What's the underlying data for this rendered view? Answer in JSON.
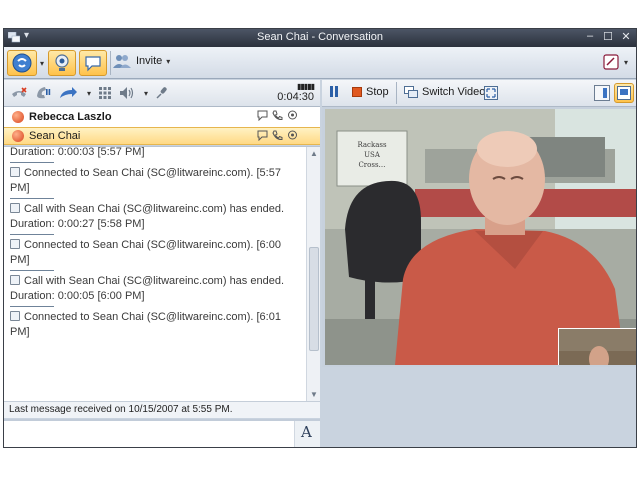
{
  "window": {
    "title": "Sean Chai - Conversation"
  },
  "toolbar": {
    "invite_label": "Invite"
  },
  "call": {
    "timer": "0:04:30"
  },
  "participants": [
    {
      "name": "Rebecca Laszlo"
    },
    {
      "name": "Sean Chai"
    }
  ],
  "history": {
    "messages": [
      {
        "line1": "Duration: 0:00:03  [5:57 PM]",
        "line2": ""
      },
      {
        "line1": "Connected to Sean Chai (SC@litwareinc.com).  [5:57",
        "line2": "PM]"
      },
      {
        "line1": "Call with Sean Chai (SC@litwareinc.com) has ended.",
        "line2": "Duration: 0:00:27  [5:58 PM]"
      },
      {
        "line1": "Connected to Sean Chai (SC@litwareinc.com).  [6:00",
        "line2": "PM]"
      },
      {
        "line1": "Call with Sean Chai (SC@litwareinc.com) has ended.",
        "line2": "Duration: 0:00:05  [6:00 PM]"
      },
      {
        "line1": "Connected to Sean Chai (SC@litwareinc.com).  [6:01",
        "line2": "PM]"
      }
    ]
  },
  "status": {
    "text": "Last message received on 10/15/2007 at 5:55 PM."
  },
  "video": {
    "stop_label": "Stop",
    "switch_label": "Switch Video",
    "sign_text": "Rackass\nUSA\nCross..."
  },
  "icons": {
    "app": "conversation-app-icon",
    "call_transfer": "phone-forward-icon",
    "hold": "hold-call-icon",
    "dialpad": "dialpad-icon",
    "volume": "speaker-icon",
    "mic": "microphone-icon",
    "presence": "presence-orb-icon",
    "font": "font-icon",
    "emoticon": "emoticon-icon"
  },
  "colors": {
    "accent": "#ffc24a",
    "stop": "#e0581f",
    "titlebar": "#2b313c"
  }
}
